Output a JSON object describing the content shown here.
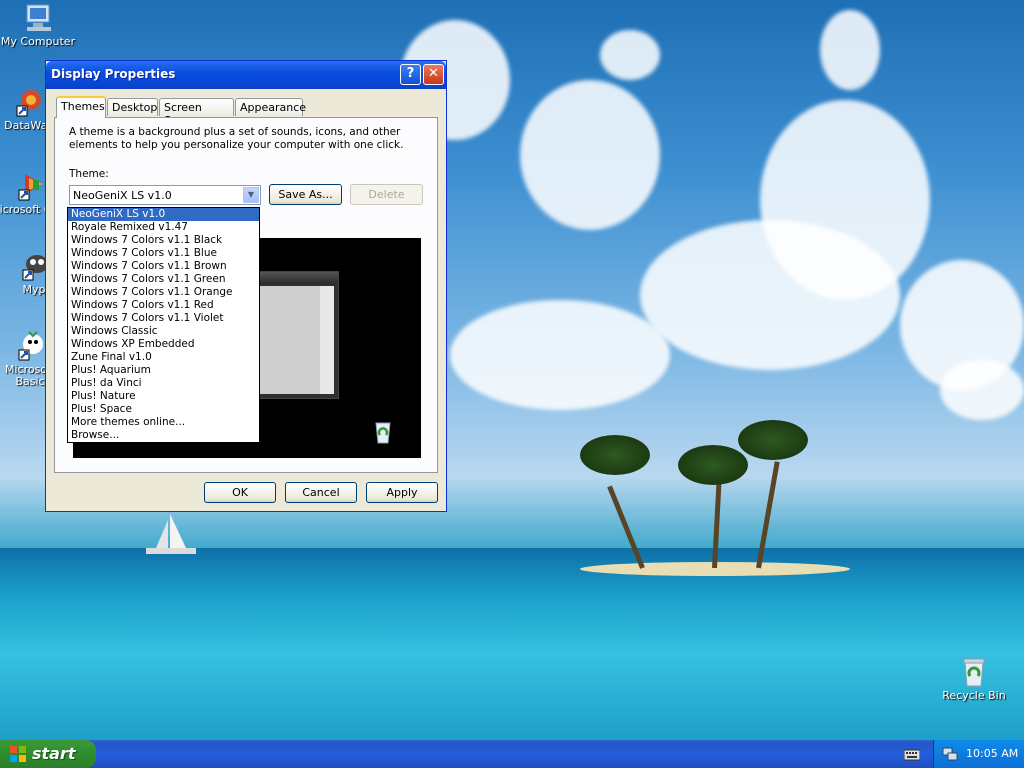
{
  "desktop": {
    "icons": [
      {
        "label": "My Computer",
        "icon": "my-computer-icon"
      },
      {
        "label": "DataWar",
        "icon": "datawarrior-shortcut-icon"
      },
      {
        "label": "Microsoft C++",
        "icon": "visual-cpp-shortcut-icon"
      },
      {
        "label": "Myp",
        "icon": "mypaint-shortcut-icon"
      },
      {
        "label": "Microsoft Basic",
        "icon": "small-basic-shortcut-icon"
      },
      {
        "label": "Recycle Bin",
        "icon": "recycle-bin-icon"
      }
    ]
  },
  "dialog": {
    "title": "Display Properties",
    "help_btn": "?",
    "close_btn": "✕",
    "tabs": [
      "Themes",
      "Desktop",
      "Screen Saver",
      "Appearance"
    ],
    "active_tab": "Themes",
    "description": "A theme is a background plus a set of sounds, icons, and other elements to help you personalize your computer with one click.",
    "theme_label": "Theme:",
    "theme_value": "NeoGeniX LS v1.0",
    "save_as": "Save As...",
    "delete": "Delete",
    "ok": "OK",
    "cancel": "Cancel",
    "apply": "Apply",
    "theme_options": [
      "NeoGeniX LS v1.0",
      "Royale Remixed v1.47",
      "Windows 7 Colors v1.1 Black",
      "Windows 7 Colors v1.1 Blue",
      "Windows 7 Colors v1.1 Brown",
      "Windows 7 Colors v1.1 Green",
      "Windows 7 Colors v1.1 Orange",
      "Windows 7 Colors v1.1 Red",
      "Windows 7 Colors v1.1 Violet",
      "Windows Classic",
      "Windows XP Embedded",
      "Zune Final v1.0",
      "Plus! Aquarium",
      "Plus! da Vinci",
      "Plus! Nature",
      "Plus! Space",
      "More themes online...",
      "Browse..."
    ],
    "selected_index": 0
  },
  "taskbar": {
    "start_label": "start",
    "clock": "10:05 AM"
  },
  "colors": {
    "selection": "#316ac5",
    "titlebar": "#0a4ee0",
    "start_green": "#2f8f2f",
    "taskbar_blue": "#245edb"
  }
}
